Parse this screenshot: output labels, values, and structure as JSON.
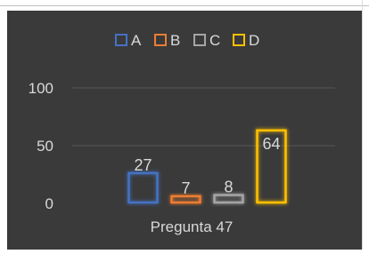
{
  "chart_data": {
    "type": "bar",
    "title": "",
    "xlabel": "Pregunta 47",
    "ylabel": "",
    "categories": [
      "Pregunta 47"
    ],
    "series": [
      {
        "name": "A",
        "values": [
          27
        ],
        "color": "#4472C4"
      },
      {
        "name": "B",
        "values": [
          7
        ],
        "color": "#ED7D31"
      },
      {
        "name": "C",
        "values": [
          8
        ],
        "color": "#A5A5A5"
      },
      {
        "name": "D",
        "values": [
          64
        ],
        "color": "#FFC000"
      }
    ],
    "ylim": [
      0,
      100
    ],
    "yticks": [
      0,
      50,
      100
    ],
    "ytick_labels": [
      "0",
      "50",
      "100"
    ],
    "grid": true,
    "legend_position": "top",
    "bar_style": "outline-glow",
    "background_color": "#3A3A3A",
    "text_color": "#D9D9D9"
  }
}
